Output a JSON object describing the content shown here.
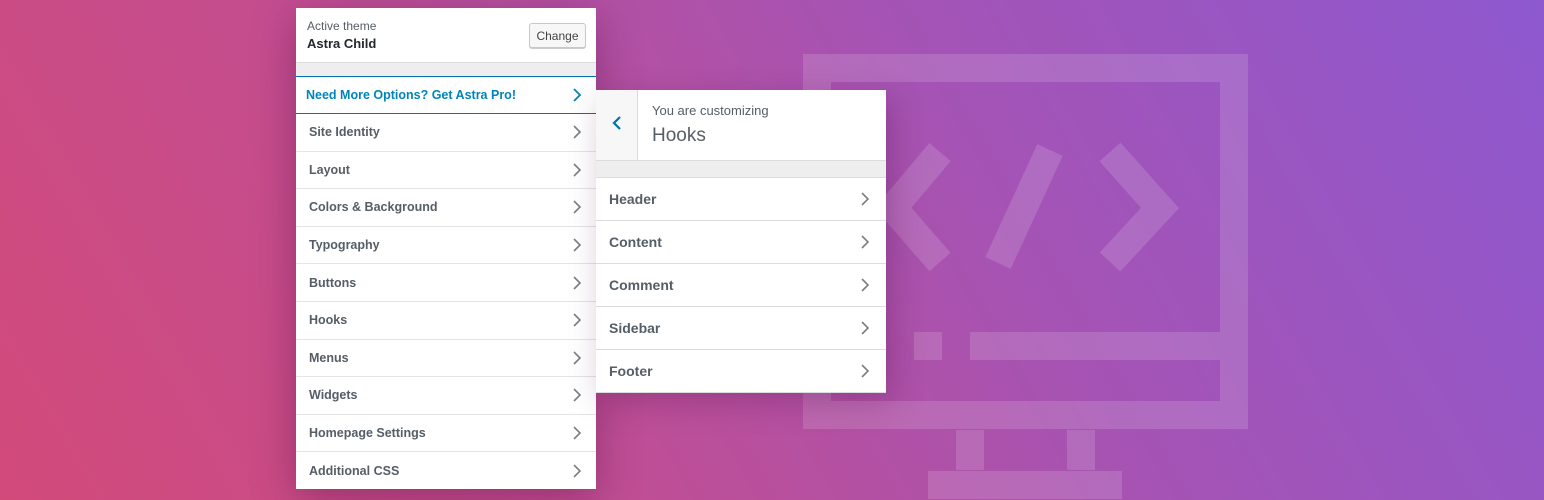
{
  "active_theme": {
    "caption": "Active theme",
    "name": "Astra Child",
    "change_label": "Change"
  },
  "promo": {
    "label": "Need More Options? Get Astra Pro!",
    "color": "#0085ba"
  },
  "sections": [
    {
      "label": "Site Identity"
    },
    {
      "label": "Layout"
    },
    {
      "label": "Colors & Background"
    },
    {
      "label": "Typography"
    },
    {
      "label": "Buttons"
    },
    {
      "label": "Hooks"
    },
    {
      "label": "Menus"
    },
    {
      "label": "Widgets"
    },
    {
      "label": "Homepage Settings"
    },
    {
      "label": "Additional CSS"
    }
  ],
  "subpanel": {
    "caption": "You are customizing",
    "title": "Hooks",
    "items": [
      {
        "label": "Header"
      },
      {
        "label": "Content"
      },
      {
        "label": "Comment"
      },
      {
        "label": "Sidebar"
      },
      {
        "label": "Footer"
      }
    ]
  },
  "icons": {
    "chevron": "chevron-right-icon",
    "back": "chevron-left-icon",
    "background": "code-monitor-icon"
  },
  "colors": {
    "gradient_start": "#d24a7a",
    "gradient_end": "#8e58cf",
    "accent": "#0073aa"
  }
}
